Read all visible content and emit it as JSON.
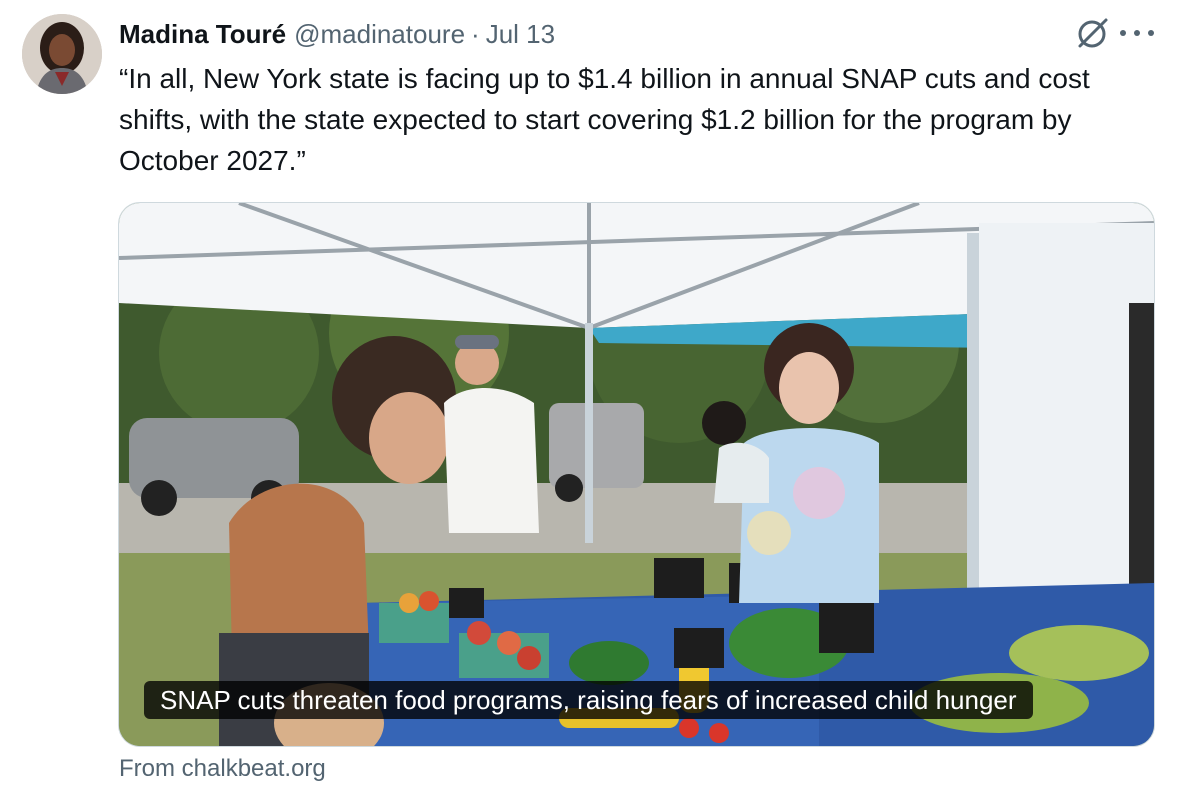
{
  "author": {
    "name": "Madina Touré",
    "handle": "@madinatoure",
    "separator": "·",
    "date": "Jul 13",
    "avatar_icon": "profile-photo"
  },
  "tweet": {
    "text": "“In all, New York state is facing up to $1.4 billion in annual SNAP cuts and cost shifts, with the state expected to start covering $1.2 billion for the program by October 2027.”"
  },
  "actions": {
    "grok_icon": "grok-icon",
    "more_icon": "more-icon"
  },
  "link_card": {
    "caption": "SNAP cuts threaten food programs, raising fears of increased child hunger",
    "source": "From chalkbeat.org",
    "photo_description_icon": "farmers-market-photo"
  },
  "colors": {
    "text_primary": "#0f1419",
    "text_secondary": "#536471",
    "border": "#cfd9de",
    "caption_bg": "#000000"
  }
}
